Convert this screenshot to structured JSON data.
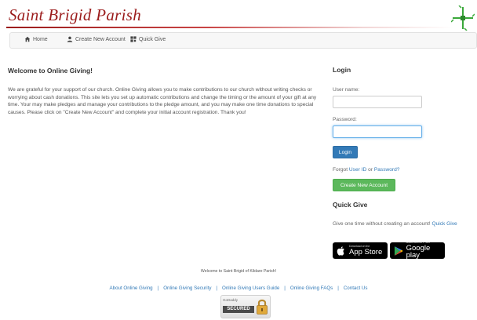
{
  "brand": {
    "name": "Saint Brigid Parish",
    "color": "#9b1c1c"
  },
  "nav": {
    "items": [
      {
        "label": "Home",
        "icon": "home-icon"
      },
      {
        "label": "Create New Account",
        "icon": "user-icon"
      },
      {
        "label": "Quick Give",
        "icon": "qrcode-icon"
      }
    ]
  },
  "welcome": {
    "title": "Welcome to Online Giving!",
    "body": "We are grateful for your support of our church. Online Giving allows you to make contributions to our church without writing checks or worrying about cash donations. This site lets you set up automatic contributions and change the timing or the amount of your gift at any time. Your may make pledges and manage your contributions to the pledge amount, and you may make one time donations to special causes. Please click on \"Create New Account\" and complete your initial account registration. Thank you!"
  },
  "login": {
    "title": "Login",
    "username_label": "User name:",
    "username_value": "",
    "password_label": "Password:",
    "password_value": "",
    "login_button": "Login",
    "forgot_prefix": "Forgot",
    "forgot_userid": "User ID",
    "forgot_or": "or",
    "forgot_password": "Password?",
    "create_button": "Create New Account"
  },
  "quickgive": {
    "title": "Quick Give",
    "text": "Give one time without creating an account!",
    "link": "Quick Give"
  },
  "badges": {
    "appstore_small": "Download on the",
    "appstore_big": "App Store",
    "google_small": "ANDROID APP ON",
    "google_big": "Google play"
  },
  "footer": {
    "welcome": "Welcome to Saint Brigid of Kildare Parish!",
    "links": [
      "About Online Giving",
      "Online Giving Security",
      "Online Giving Users Guide",
      "Online Giving FAQs",
      "Contact Us"
    ],
    "separator": "|",
    "seal_brand": "GoDaddy",
    "seal_text": "SECURED"
  },
  "colors": {
    "primary": "#337ab7",
    "success": "#5cb85c",
    "cross": "#3aa83a"
  }
}
